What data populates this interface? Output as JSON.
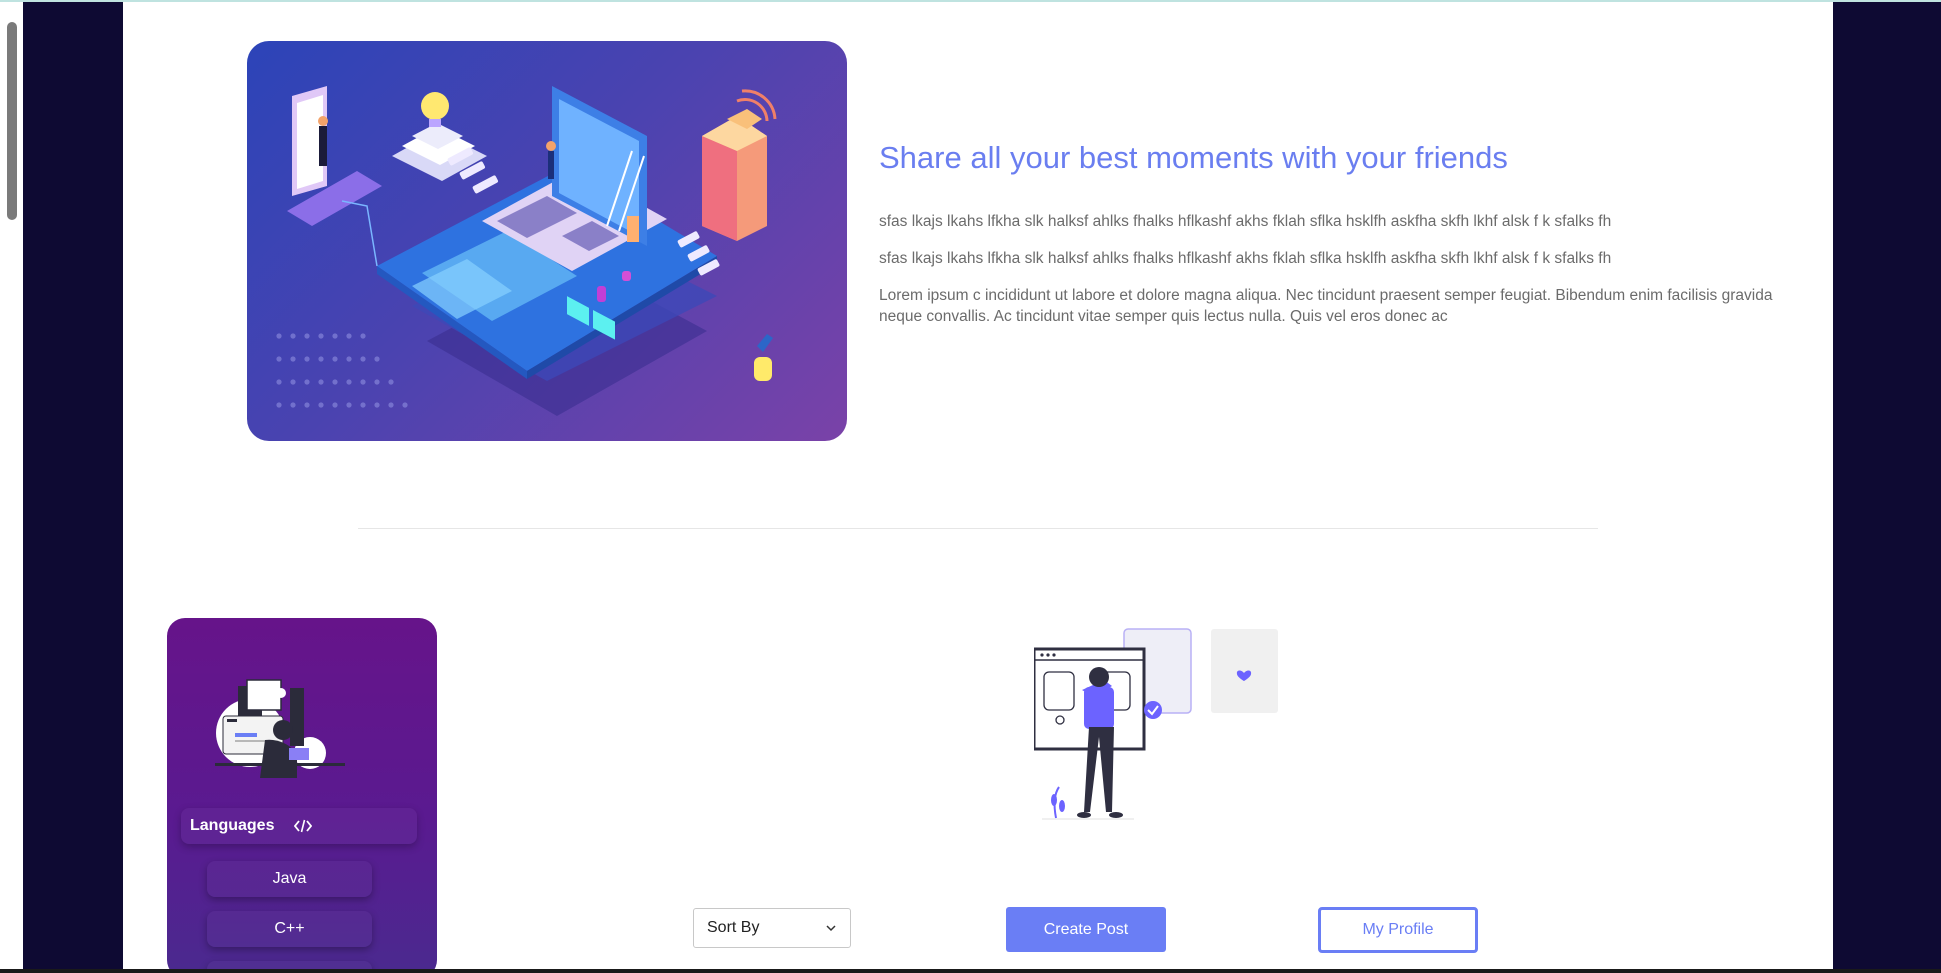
{
  "hero": {
    "title": "Share all your best moments with your friends",
    "paragraphs": [
      "sfas lkajs lkahs lfkha slk halksf ahlks fhalks hflkashf akhs fklah sflka hsklfh askfha skfh lkhf alsk f k sfalks fh",
      "sfas lkajs lkahs lfkha slk halksf ahlks fhalks hflkashf akhs fklah sflka hsklfh askfha skfh lkhf alsk f k sfalks fh",
      "Lorem ipsum c incididunt ut labore et dolore magna aliqua. Nec tincidunt praesent semper feugiat. Bibendum enim facilisis gravida neque convallis. Ac tincidunt vitae semper quis lectus nulla. Quis vel eros donec ac"
    ]
  },
  "sidebar": {
    "heading": "Languages",
    "items": [
      "Java",
      "C++",
      ""
    ]
  },
  "controls": {
    "sort_label": "Sort By",
    "create_label": "Create Post",
    "profile_label": "My Profile"
  },
  "colors": {
    "accent": "#6a7ef5",
    "sidebar_top": "#66148a",
    "sidebar_bottom": "#4a2a8f",
    "page_bg_dark": "#0e0a33"
  },
  "icons": [
    "code-icon",
    "heart-icon",
    "check-icon",
    "chevron-down-icon"
  ]
}
